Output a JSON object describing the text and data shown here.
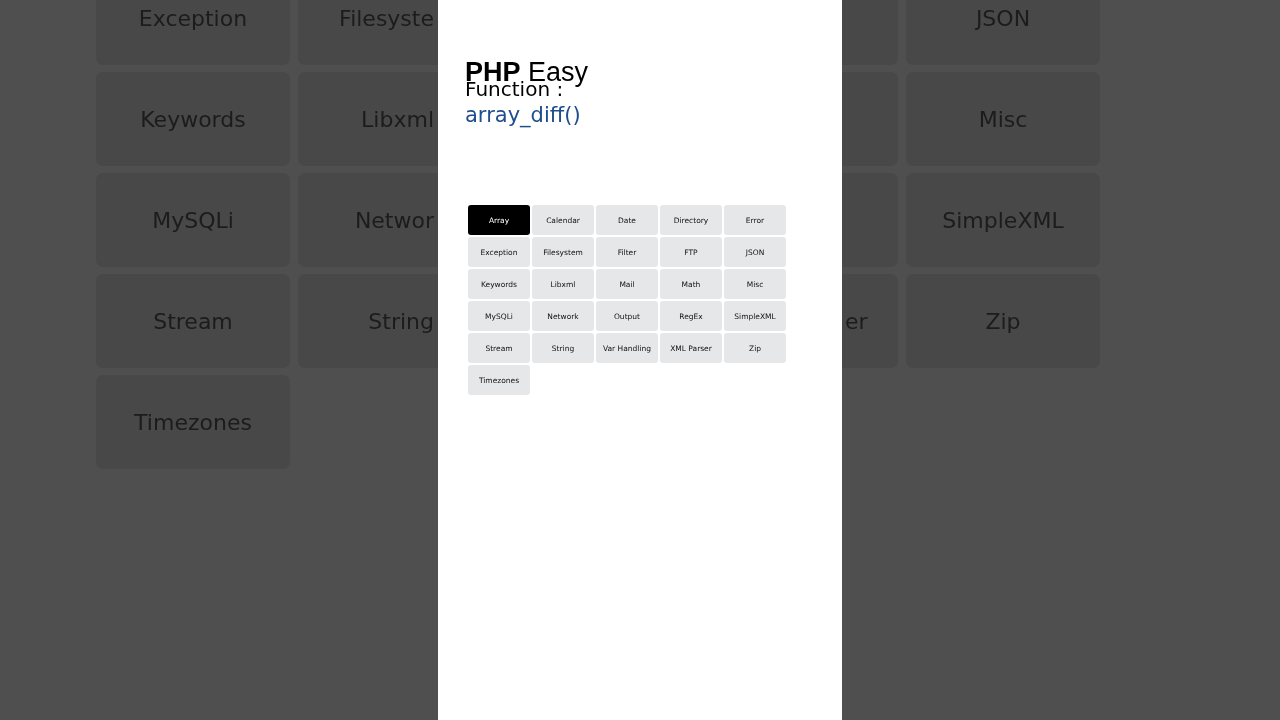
{
  "backdrop": {
    "left_rows": [
      [
        "Exception",
        "Filesyste"
      ],
      [
        "Keywords",
        "Libxml"
      ],
      [
        "MySQLi",
        "Networ"
      ],
      [
        "Stream",
        "String"
      ],
      [
        "Timezones"
      ]
    ],
    "right_rows": [
      {
        "label": "JSON"
      },
      {
        "label": "Misc"
      },
      {
        "label": "SimpleXML"
      },
      {
        "edge": "er",
        "label": "Zip"
      }
    ]
  },
  "panel": {
    "title": "**PHP** Easy",
    "caption": "Function :",
    "function_name": "array_diff()",
    "categories": [
      {
        "label": "Array",
        "selected": true
      },
      {
        "label": "Calendar",
        "selected": false
      },
      {
        "label": "Date",
        "selected": false
      },
      {
        "label": "Directory",
        "selected": false
      },
      {
        "label": "Error",
        "selected": false
      },
      {
        "label": "Exception",
        "selected": false
      },
      {
        "label": "Filesystem",
        "selected": false
      },
      {
        "label": "Filter",
        "selected": false
      },
      {
        "label": "FTP",
        "selected": false
      },
      {
        "label": "JSON",
        "selected": false
      },
      {
        "label": "Keywords",
        "selected": false
      },
      {
        "label": "Libxml",
        "selected": false
      },
      {
        "label": "Mail",
        "selected": false
      },
      {
        "label": "Math",
        "selected": false
      },
      {
        "label": "Misc",
        "selected": false
      },
      {
        "label": "MySQLi",
        "selected": false
      },
      {
        "label": "Network",
        "selected": false
      },
      {
        "label": "Output",
        "selected": false
      },
      {
        "label": "RegEx",
        "selected": false
      },
      {
        "label": "SimpleXML",
        "selected": false
      },
      {
        "label": "Stream",
        "selected": false
      },
      {
        "label": "String",
        "selected": false
      },
      {
        "label": "Var Handling",
        "selected": false
      },
      {
        "label": "XML Parser",
        "selected": false
      },
      {
        "label": "Zip",
        "selected": false
      },
      {
        "label": "Timezones",
        "selected": false
      }
    ]
  }
}
